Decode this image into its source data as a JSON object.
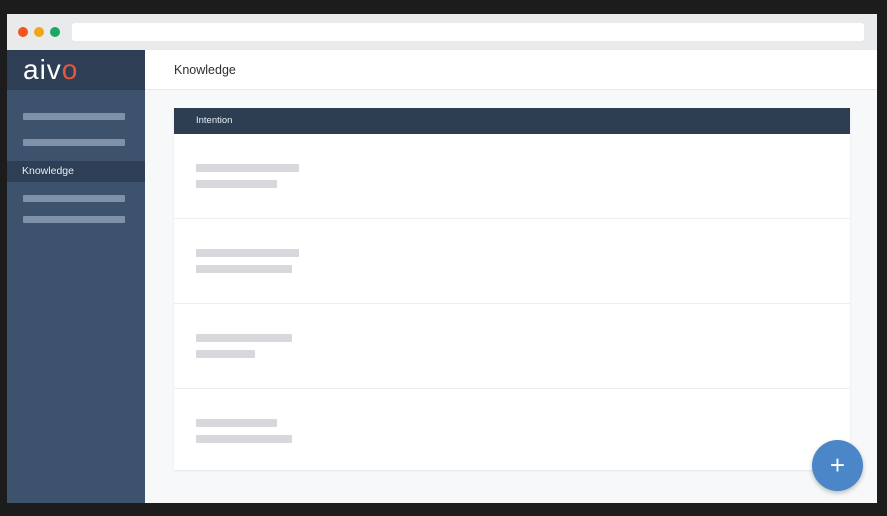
{
  "window": {
    "controls": [
      {
        "name": "close",
        "color": "#f2541b"
      },
      {
        "name": "minimize",
        "color": "#f2a51b"
      },
      {
        "name": "zoom",
        "color": "#1ba866"
      }
    ]
  },
  "logo": {
    "text_main": "aiv",
    "text_accent": "o",
    "accent_color": "#e8563b"
  },
  "sidebar": {
    "active_item": "Knowledge"
  },
  "header": {
    "title": "Knowledge"
  },
  "panel": {
    "column_header": "Intention"
  },
  "fab": {
    "icon": "plus-icon",
    "glyph": "+",
    "color": "#4a86c8"
  }
}
